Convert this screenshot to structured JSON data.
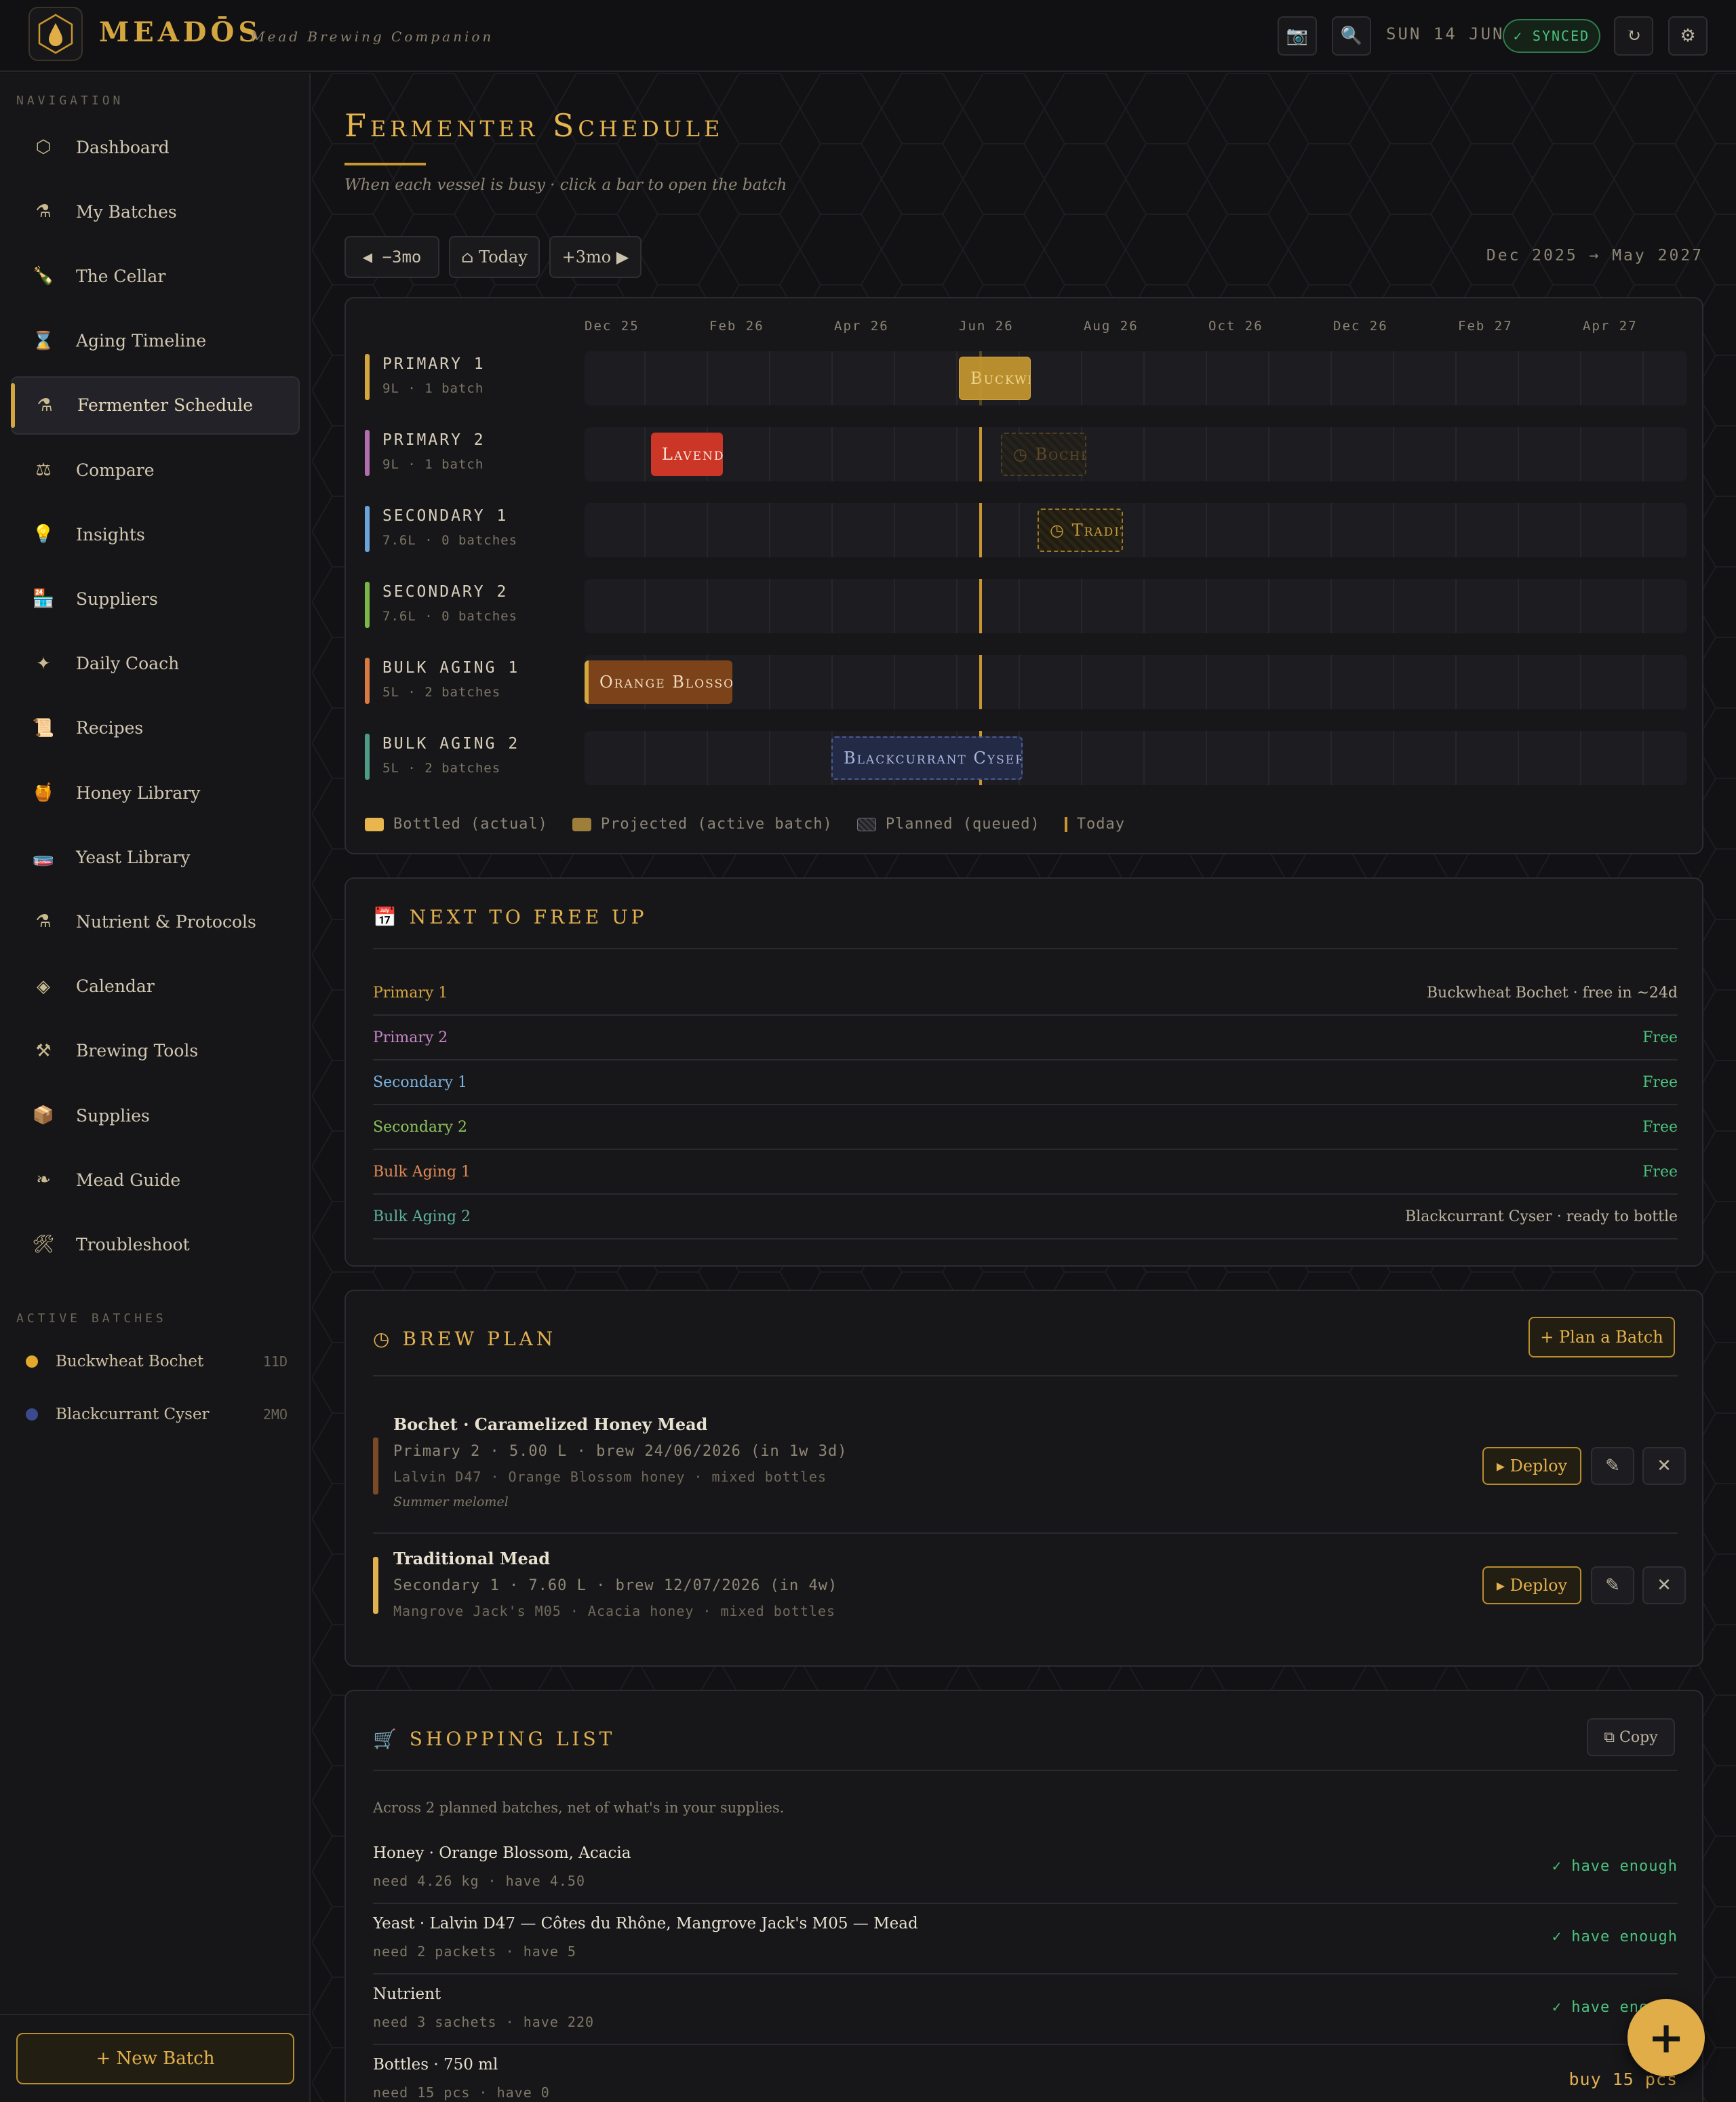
{
  "header": {
    "brand": "MEADŌS",
    "subtitle": "Mead Brewing Companion",
    "date": "SUN 14 JUN",
    "synced": "✓ SYNCED",
    "camera_icon": "📷",
    "search_icon": "🔍",
    "refresh_icon": "↻",
    "settings_icon": "⚙"
  },
  "sidebar": {
    "nav_heading": "NAVIGATION",
    "items": [
      {
        "icon": "⬡",
        "label": "Dashboard"
      },
      {
        "icon": "⚗",
        "label": "My Batches"
      },
      {
        "icon": "🍾",
        "label": "The Cellar"
      },
      {
        "icon": "⌛",
        "label": "Aging Timeline"
      },
      {
        "icon": "⚗",
        "label": "Fermenter Schedule"
      },
      {
        "icon": "⚖",
        "label": "Compare"
      },
      {
        "icon": "💡",
        "label": "Insights"
      },
      {
        "icon": "🏪",
        "label": "Suppliers"
      },
      {
        "icon": "✦",
        "label": "Daily Coach"
      },
      {
        "icon": "📜",
        "label": "Recipes"
      },
      {
        "icon": "🍯",
        "label": "Honey Library"
      },
      {
        "icon": "🧫",
        "label": "Yeast Library"
      },
      {
        "icon": "⚗",
        "label": "Nutrient & Protocols"
      },
      {
        "icon": "◈",
        "label": "Calendar"
      },
      {
        "icon": "⚒",
        "label": "Brewing Tools"
      },
      {
        "icon": "📦",
        "label": "Supplies"
      },
      {
        "icon": "❧",
        "label": "Mead Guide"
      },
      {
        "icon": "🛠",
        "label": "Troubleshoot"
      }
    ],
    "active_heading": "ACTIVE BATCHES",
    "active_batches": [
      {
        "name": "Buckwheat Bochet",
        "age": "11D",
        "color": "#e2a92b"
      },
      {
        "name": "Blackcurrant Cyser",
        "age": "2MO",
        "color": "#3b4a8c"
      }
    ],
    "new_batch": "+ New Batch"
  },
  "page": {
    "title": "Fermenter Schedule",
    "subtitle": "When each vessel is busy · click a bar to open the batch",
    "prev": "◀ −3mo",
    "today": "⌂ Today",
    "next": "+3mo ▶",
    "range": "Dec 2025 → May 2027"
  },
  "gantt": {
    "months": [
      "Dec 25",
      "Feb 26",
      "Apr 26",
      "Jun 26",
      "Aug 26",
      "Oct 26",
      "Dec 26",
      "Feb 27",
      "Apr 27"
    ],
    "rows": [
      {
        "name": "PRIMARY 1",
        "meta": "9L · 1 batch",
        "color": "#d4a640"
      },
      {
        "name": "PRIMARY 2",
        "meta": "9L · 1 batch",
        "color": "#b06db0"
      },
      {
        "name": "SECONDARY 1",
        "meta": "7.6L · 0 batches",
        "color": "#6aa4d8"
      },
      {
        "name": "SECONDARY 2",
        "meta": "7.6L · 0 batches",
        "color": "#7ab648"
      },
      {
        "name": "BULK AGING 1",
        "meta": "5L · 2 batches",
        "color": "#d97a45"
      },
      {
        "name": "BULK AGING 2",
        "meta": "5L · 2 batches",
        "color": "#4f9c86"
      }
    ],
    "bars": {
      "p1": "Buckwheat Bochet",
      "p2a": "Lavender Melomel",
      "p2b": "◷ Bochet",
      "s1": "◷ Traditional",
      "b1": "Orange Blossom",
      "b2": "Blackcurrant Cyser"
    },
    "legend": {
      "bottled": "Bottled (actual)",
      "projected": "Projected (active batch)",
      "planned": "Planned (queued)",
      "today": "Today"
    }
  },
  "free_up": {
    "title": "📅 NEXT TO FREE UP",
    "rows": [
      {
        "name": "Primary 1",
        "status": "Buckwheat Bochet · free in ~24d",
        "color": "#d4a640"
      },
      {
        "name": "Primary 2",
        "status": "Free",
        "color": "#c685c6"
      },
      {
        "name": "Secondary 1",
        "status": "Free",
        "color": "#7db3e0"
      },
      {
        "name": "Secondary 2",
        "status": "Free",
        "color": "#8dc25c"
      },
      {
        "name": "Bulk Aging 1",
        "status": "Free",
        "color": "#e08a55"
      },
      {
        "name": "Bulk Aging 2",
        "status": "Blackcurrant Cyser · ready to bottle",
        "color": "#5fb09a"
      }
    ]
  },
  "brew_plan": {
    "title": "◷ BREW PLAN",
    "plan_button": "+ Plan a Batch",
    "deploy": "▸ Deploy",
    "edit_icon": "✎",
    "close_icon": "✕",
    "items": [
      {
        "name": "Bochet · Caramelized Honey Mead",
        "line": "Primary 2 · 5.00 L · brew 24/06/2026 (in 1w 3d)",
        "line2": "Lalvin D47 · Orange Blossom honey · mixed bottles",
        "note": "Summer melomel",
        "color": "#7a4a24"
      },
      {
        "name": "Traditional Mead",
        "line": "Secondary 1 · 7.60 L · brew 12/07/2026 (in 4w)",
        "line2": "Mangrove Jack's M05 · Acacia honey · mixed bottles",
        "note": "",
        "color": "#e2b04e"
      }
    ]
  },
  "shopping": {
    "title": "🛒 SHOPPING LIST",
    "copy": "⧉ Copy",
    "note": "Across 2 planned batches, net of what's in your supplies.",
    "rows": [
      {
        "name": "Honey · Orange Blossom, Acacia",
        "need": "need 4.26 kg · have 4.50",
        "status": "✓ have enough"
      },
      {
        "name": "Yeast · Lalvin D47 — Côtes du Rhône, Mangrove Jack's M05 — Mead",
        "need": "need 2 packets · have 5",
        "status": "✓ have enough"
      },
      {
        "name": "Nutrient",
        "need": "need 3 sachets · have 220",
        "status": "✓ have enough"
      },
      {
        "name": "Bottles · 750 ml",
        "need": "need 15 pcs · have 0",
        "status": "buy 15 pcs"
      }
    ]
  },
  "fab": "+"
}
